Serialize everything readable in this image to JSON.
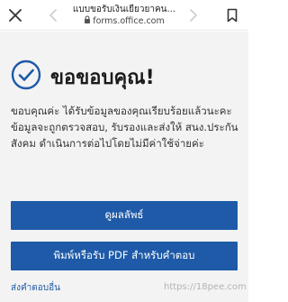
{
  "browser": {
    "page_title": "แบบขอรับเงินเยียวยาคน...",
    "host": "forms.office.com"
  },
  "confirmation": {
    "heading": "ขอขอบคุณ!",
    "message": "ขอบคุณค่ะ ได้รับข้อมูลของคุณเรียบร้อยแล้วนะคะ ข้อมูลจะถูกตรวจสอบ, รับรองและส่งให้ สนง.ประกันสังคม ดำเนินการต่อไปโดยไม่มีค่าใช้จ่ายค่ะ",
    "view_results_label": "ดูผลลัพธ์",
    "print_pdf_label": "พิมพ์หรือรับ PDF สำหรับคำตอบ",
    "submit_another_label": "ส่งคำตอบอื่น"
  },
  "watermark": "https://18pee.com",
  "colors": {
    "accent": "#1e5aa8",
    "background": "#f3f3f3"
  },
  "icons": {
    "close": "close-icon",
    "back": "chevron-left-icon",
    "forward": "chevron-right-icon",
    "lock": "lock-icon",
    "bookmark": "bookmark-icon",
    "success": "check-circle-icon"
  }
}
